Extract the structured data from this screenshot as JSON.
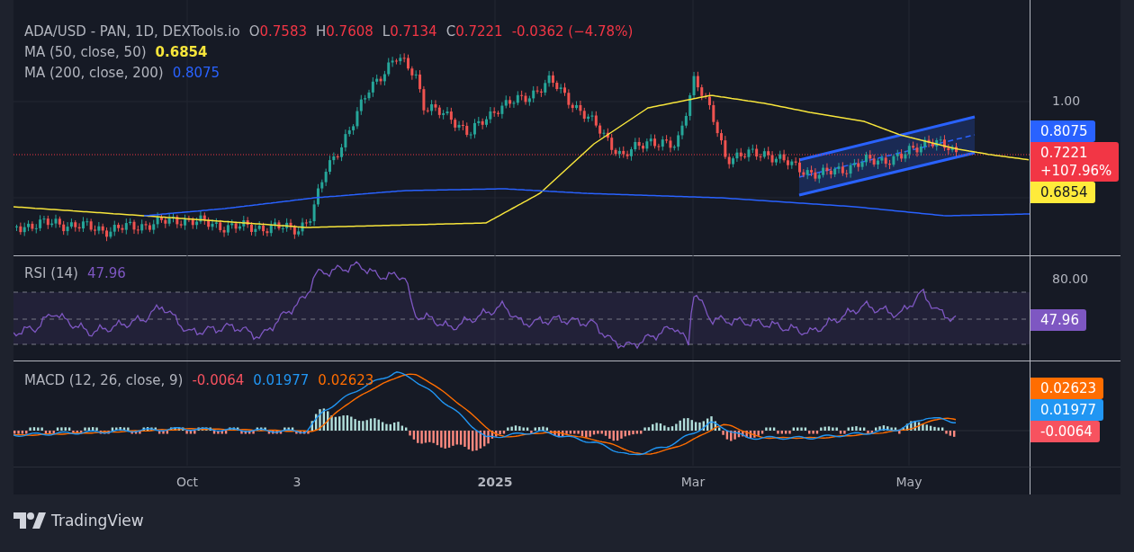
{
  "legend": {
    "symbol": "ADA/USD - PAN, 1D, DEXTools.io",
    "ohlc": [
      {
        "label": "O",
        "value": "0.7583"
      },
      {
        "label": "H",
        "value": "0.7608"
      },
      {
        "label": "L",
        "value": "0.7134"
      },
      {
        "label": "C",
        "value": "0.7221"
      }
    ],
    "change": "-0.0362 (−4.78%)"
  },
  "indicators": [
    {
      "name": "MA (50, close, 50)",
      "value": "0.6854",
      "color": "#f7e53b"
    },
    {
      "name": "MA (200, close, 200)",
      "value": "0.8075",
      "color": "#2962ff"
    }
  ],
  "price_axis": {
    "ticks": [
      "1.00"
    ],
    "badges": [
      {
        "lines": [
          "0.8075"
        ],
        "color": "#2962ff",
        "dark_text": false
      },
      {
        "lines": [
          "0.7221",
          "+107.96%"
        ],
        "color": "#f23645",
        "dark_text": false
      },
      {
        "lines": [
          "0.6854"
        ],
        "color": "#ffeb3b",
        "dark_text": true
      }
    ]
  },
  "rsi": {
    "title": "RSI (14)",
    "value": "47.96",
    "ticks": [
      "80.00"
    ],
    "badge": {
      "text": "47.96",
      "color": "#7e57c2"
    }
  },
  "macd": {
    "title": "MACD (12, 26, close, 9)",
    "values": [
      {
        "text": "-0.0064",
        "color": "#f7525f"
      },
      {
        "text": "0.01977",
        "color": "#2196f3"
      },
      {
        "text": "0.02623",
        "color": "#ff6d00"
      }
    ],
    "badges": [
      {
        "text": "0.02623",
        "color": "#ff6d00"
      },
      {
        "text": "0.01977",
        "color": "#2196f3"
      },
      {
        "text": "-0.0064",
        "color": "#f7525f"
      }
    ]
  },
  "time_axis": [
    {
      "label": "Oct",
      "bold": false
    },
    {
      "label": "3",
      "bold": false
    },
    {
      "label": "2025",
      "bold": true
    },
    {
      "label": "Mar",
      "bold": false
    },
    {
      "label": "May",
      "bold": false
    }
  ],
  "footer": {
    "brand": "TradingView"
  }
}
